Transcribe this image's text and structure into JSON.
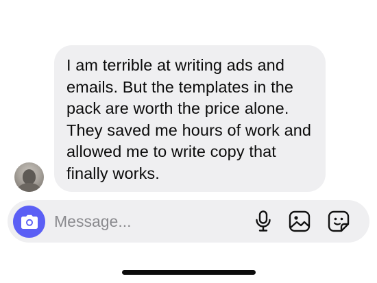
{
  "conversation": {
    "message": {
      "text": "I am terrible at writing ads and emails. But the templates in the pack are worth the price alone. They saved me hours of work and allowed me to write copy that finally works."
    }
  },
  "composer": {
    "placeholder": "Message...",
    "accent_color": "#5b5ff5",
    "icons": [
      "camera-icon",
      "microphone-icon",
      "gallery-icon",
      "sticker-icon"
    ]
  }
}
